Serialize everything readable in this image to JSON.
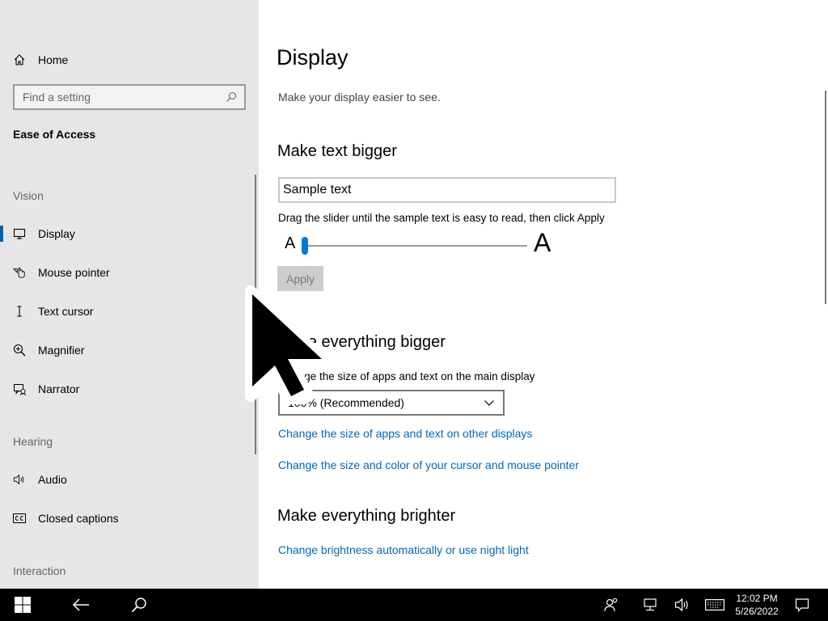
{
  "sidebar": {
    "home_label": "Home",
    "search_placeholder": "Find a setting",
    "section_title": "Ease of Access",
    "groups": {
      "vision": "Vision",
      "hearing": "Hearing",
      "interaction": "Interaction"
    },
    "items": [
      {
        "label": "Display",
        "icon": "monitor-icon",
        "selected": true
      },
      {
        "label": "Mouse pointer",
        "icon": "mouse-pointer-icon"
      },
      {
        "label": "Text cursor",
        "icon": "text-cursor-icon"
      },
      {
        "label": "Magnifier",
        "icon": "magnifier-icon"
      },
      {
        "label": "Narrator",
        "icon": "narrator-icon"
      },
      {
        "label": "Audio",
        "icon": "speaker-icon"
      },
      {
        "label": "Closed captions",
        "icon": "closed-captions-icon"
      }
    ]
  },
  "main": {
    "title": "Display",
    "subtitle": "Make your display easier to see.",
    "text_bigger": {
      "heading": "Make text bigger",
      "sample_text": "Sample text",
      "hint": "Drag the slider until the sample text is easy to read, then click Apply",
      "slider_min_label": "A",
      "slider_max_label": "A",
      "slider_value": 0,
      "apply_label": "Apply"
    },
    "everything_bigger": {
      "heading": "Make everything bigger",
      "description": "Change the size of apps and text on the main display",
      "dropdown_value": "100% (Recommended)",
      "link_other_displays": "Change the size of apps and text on other displays",
      "link_cursor": "Change the size and color of your cursor and mouse pointer"
    },
    "everything_brighter": {
      "heading": "Make everything brighter",
      "link_brightness": "Change brightness automatically or use night light"
    }
  },
  "taskbar": {
    "time": "12:02 PM",
    "date": "5/26/2022"
  },
  "colors": {
    "accent": "#0078d7",
    "link": "#0067b8",
    "sidebar_bg": "#e6e6e6",
    "taskbar_bg": "#000000"
  }
}
